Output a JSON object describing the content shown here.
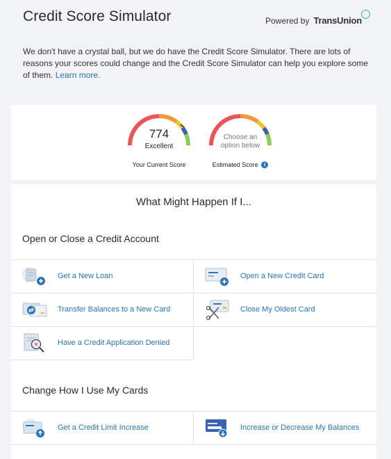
{
  "header": {
    "title": "Credit Score Simulator",
    "powered_by": "Powered by",
    "brand": "TransUnion",
    "intro": "We don't have a crystal ball, but we do have the Credit Score Simulator. There are lots of reasons your scores could change and the Credit Score Simulator can help you explore some of them.",
    "learn_more": "Learn more."
  },
  "gauges": {
    "current": {
      "value": "774",
      "rating": "Excellent",
      "label": "Your Current Score"
    },
    "estimated": {
      "placeholder": "Choose an option below",
      "label": "Estimated Score",
      "info_icon": "i"
    }
  },
  "main": {
    "heading": "What Might Happen If I...",
    "sections": [
      {
        "title": "Open or Close a Credit Account",
        "options": [
          {
            "label": "Get a New Loan",
            "icon": "loan-icon"
          },
          {
            "label": "Open a New Credit Card",
            "icon": "new-card-icon"
          },
          {
            "label": "Transfer Balances to a New Card",
            "icon": "transfer-icon"
          },
          {
            "label": "Close My Oldest Card",
            "icon": "scissors-card-icon"
          },
          {
            "label": "Have a Credit Application Denied",
            "icon": "denied-application-icon"
          }
        ]
      },
      {
        "title": "Change How I Use My Cards",
        "options": [
          {
            "label": "Get a Credit Limit Increase",
            "icon": "limit-increase-icon"
          },
          {
            "label": "Increase or Decrease My Balances",
            "icon": "balance-icon"
          }
        ]
      }
    ]
  },
  "colors": {
    "link": "#2b74b8",
    "gauge_red": "#e8565a",
    "gauge_yellow": "#f3c32f",
    "gauge_blue": "#3a62ad",
    "gauge_green": "#8ccc5c",
    "background": "#f2f3f5"
  }
}
